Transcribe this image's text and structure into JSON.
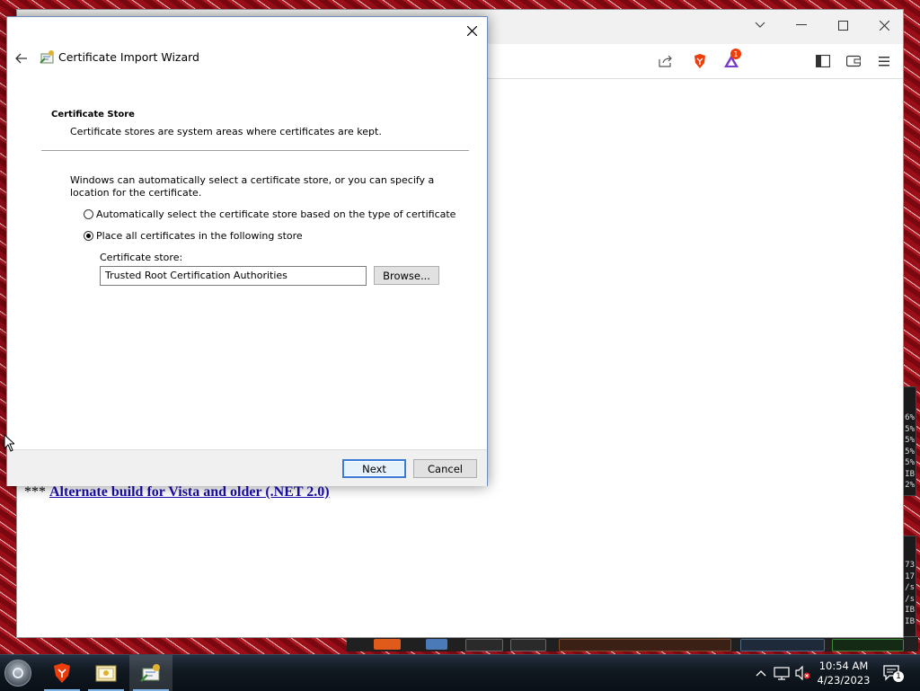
{
  "dialog": {
    "title": "Certificate Import Wizard",
    "section_heading": "Certificate Store",
    "section_description": "Certificate stores are system areas where certificates are kept.",
    "intro_text": "Windows can automatically select a certificate store, or you can specify a location for the certificate.",
    "options": [
      {
        "label": "Automatically select the certificate store based on the type of certificate",
        "selected": false
      },
      {
        "label": "Place all certificates in the following store",
        "selected": true
      }
    ],
    "store_label": "Certificate store:",
    "store_value": "Trusted Root Certification Authorities",
    "browse_label": "Browse...",
    "next_label": "Next",
    "cancel_label": "Cancel"
  },
  "browser": {
    "notification_count": "1",
    "page_prefix": "***",
    "page_link": "Alternate build for Vista and older (.NET 2.0)"
  },
  "gadgets": {
    "top": [
      "6%",
      "5%",
      "5%",
      "5%",
      "5%",
      "IB",
      "2%"
    ],
    "bottom": [
      "73",
      "17",
      "/s",
      "/s",
      "IB",
      "IB"
    ]
  },
  "taskbar": {
    "time": "10:54 AM",
    "date": "4/23/2023",
    "notification_badge": "1"
  },
  "colors": {
    "accent": "#3a7bd5",
    "brave_orange": "#ec3d0b",
    "link": "#1a0dab"
  },
  "icons": {
    "back": "arrow-left-icon",
    "close": "close-icon",
    "app": "certificate-wizard-icon"
  }
}
